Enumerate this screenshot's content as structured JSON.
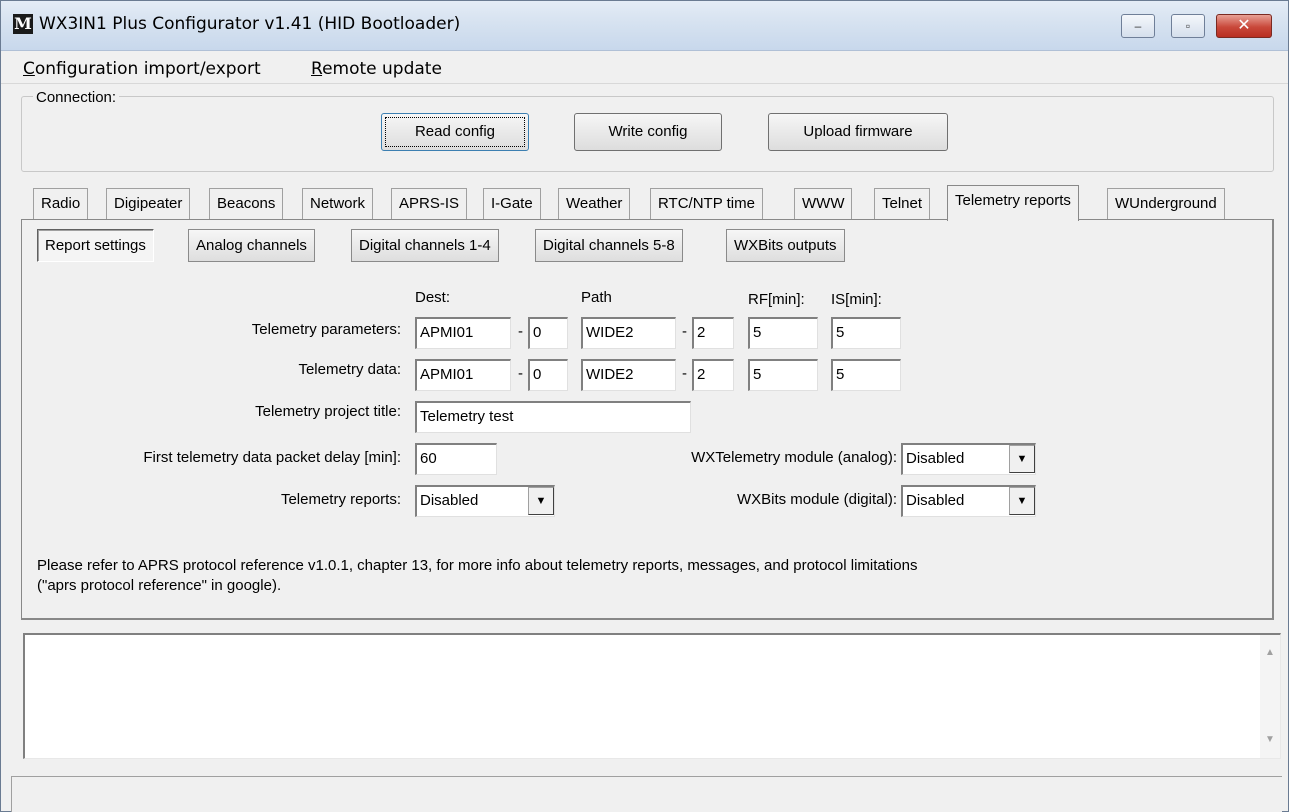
{
  "window": {
    "title": "WX3IN1 Plus Configurator v1.41 (HID Bootloader)",
    "icon_letter": "M",
    "min_glyph": "‒",
    "max_glyph": "▫",
    "close_glyph": "✕"
  },
  "menu": {
    "items": [
      {
        "first": "C",
        "rest": "onfiguration import/export"
      },
      {
        "first": "R",
        "rest": "emote update"
      }
    ]
  },
  "connection": {
    "legend": "Connection:",
    "read_label": "Read config",
    "write_label": "Write config",
    "upload_label": "Upload firmware"
  },
  "tabs": [
    {
      "label": "Radio"
    },
    {
      "label": "Digipeater"
    },
    {
      "label": "Beacons"
    },
    {
      "label": "Network"
    },
    {
      "label": "APRS-IS"
    },
    {
      "label": "I-Gate"
    },
    {
      "label": "Weather"
    },
    {
      "label": "RTC/NTP time"
    },
    {
      "label": "WWW"
    },
    {
      "label": "Telnet"
    },
    {
      "label": "Telemetry reports"
    },
    {
      "label": "WUnderground"
    }
  ],
  "subtabs": [
    {
      "label": "Report settings"
    },
    {
      "label": "Analog channels"
    },
    {
      "label": "Digital channels 1-4"
    },
    {
      "label": "Digital channels 5-8"
    },
    {
      "label": "WXBits outputs"
    }
  ],
  "form": {
    "col_dest": "Dest:",
    "col_path": "Path",
    "col_rf": "RF[min]:",
    "col_is": "IS[min]:",
    "dash": "-",
    "params": {
      "label": "Telemetry parameters:",
      "dest": "APMI01",
      "dest_ssid": "0",
      "path": "WIDE2",
      "path_n": "2",
      "rf": "5",
      "is": "5"
    },
    "data": {
      "label": "Telemetry data:",
      "dest": "APMI01",
      "dest_ssid": "0",
      "path": "WIDE2",
      "path_n": "2",
      "rf": "5",
      "is": "5"
    },
    "project_title_label": "Telemetry project title:",
    "project_title": "Telemetry test",
    "delay_label": "First telemetry data packet delay [min]:",
    "delay": "60",
    "reports_label": "Telemetry reports:",
    "reports": "Disabled",
    "wxtelemetry_label": "WXTelemetry module (analog):",
    "wxtelemetry": "Disabled",
    "wxbits_label": "WXBits module (digital):",
    "wxbits": "Disabled",
    "arrow": "▼"
  },
  "note_line1": "Please refer to APRS protocol reference v1.0.1, chapter 13, for more info about telemetry reports, messages, and protocol limitations",
  "note_line2": "(\"aprs protocol reference\" in google).",
  "log": {
    "up": "▲",
    "down": "▼"
  }
}
